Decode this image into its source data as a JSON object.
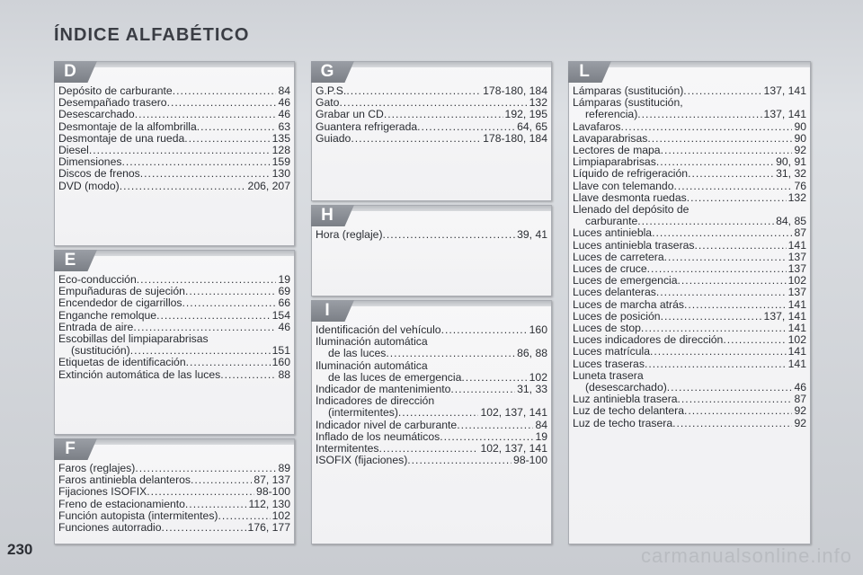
{
  "title": "ÍNDICE ALFABÉTICO",
  "page_number": "230",
  "watermark": "carmanualsonline.info",
  "sections": {
    "D": {
      "letter": "D",
      "entries": [
        {
          "t": "Depósito de carburante",
          "p": "84"
        },
        {
          "t": "Desempañado trasero",
          "p": "46"
        },
        {
          "t": "Desescarchado",
          "p": "46"
        },
        {
          "t": "Desmontaje de la alfombrilla",
          "p": "63"
        },
        {
          "t": "Desmontaje de una rueda",
          "p": "135"
        },
        {
          "t": "Diesel",
          "p": "128"
        },
        {
          "t": "Dimensiones",
          "p": "159"
        },
        {
          "t": "Discos de frenos",
          "p": "130"
        },
        {
          "t": "DVD (modo)",
          "p": "206, 207"
        }
      ]
    },
    "E": {
      "letter": "E",
      "entries": [
        {
          "t": "Eco-conducción",
          "p": "19"
        },
        {
          "t": "Empuñaduras de sujeción",
          "p": "69"
        },
        {
          "t": "Encendedor de cigarrillos",
          "p": "66"
        },
        {
          "t": "Enganche remolque",
          "p": "154"
        },
        {
          "t": "Entrada de aire",
          "p": "46"
        },
        {
          "t": "Escobillas del limpiaparabrisas",
          "p": ""
        },
        {
          "t": "(sustitución)",
          "p": "151"
        },
        {
          "t": "Etiquetas de identificación",
          "p": "160"
        },
        {
          "t": "Extinción automática de las luces",
          "p": "88"
        }
      ]
    },
    "F": {
      "letter": "F",
      "entries": [
        {
          "t": "Faros (reglajes)",
          "p": "89"
        },
        {
          "t": "Faros antiniebla delanteros",
          "p": "87, 137"
        },
        {
          "t": "Fijaciones ISOFIX",
          "p": "98-100"
        },
        {
          "t": "Freno de estacionamiento",
          "p": "112, 130"
        },
        {
          "t": "Función autopista (intermitentes)",
          "p": "102"
        },
        {
          "t": "Funciones autorradio",
          "p": "176, 177"
        }
      ]
    },
    "G": {
      "letter": "G",
      "entries": [
        {
          "t": "G.P.S.",
          "p": "178-180, 184"
        },
        {
          "t": "Gato",
          "p": "132"
        },
        {
          "t": "Grabar un CD",
          "p": "192, 195"
        },
        {
          "t": "Guantera refrigerada",
          "p": "64, 65"
        },
        {
          "t": "Guiado",
          "p": "178-180, 184"
        }
      ]
    },
    "H": {
      "letter": "H",
      "entries": [
        {
          "t": "Hora (reglaje)",
          "p": "39, 41"
        }
      ]
    },
    "I": {
      "letter": "I",
      "entries": [
        {
          "t": "Identificación del vehículo",
          "p": "160"
        },
        {
          "t": "Iluminación automática",
          "p": ""
        },
        {
          "t": "de las luces",
          "p": "86, 88"
        },
        {
          "t": "Iluminación automática",
          "p": ""
        },
        {
          "t": "de las luces de emergencia",
          "p": "102"
        },
        {
          "t": "Indicador de mantenimiento",
          "p": "31, 33"
        },
        {
          "t": "Indicadores de dirección",
          "p": ""
        },
        {
          "t": "(intermitentes)",
          "p": "102, 137, 141"
        },
        {
          "t": "Indicador nivel de carburante",
          "p": "84"
        },
        {
          "t": "Inflado de los neumáticos",
          "p": "19"
        },
        {
          "t": "Intermitentes",
          "p": "102, 137, 141"
        },
        {
          "t": "ISOFIX (fijaciones)",
          "p": "98-100"
        }
      ]
    },
    "L": {
      "letter": "L",
      "entries": [
        {
          "t": "Lámparas (sustitución)",
          "p": "137, 141"
        },
        {
          "t": "Lámparas (sustitución,",
          "p": ""
        },
        {
          "t": "referencia)",
          "p": "137, 141"
        },
        {
          "t": "Lavafaros",
          "p": "90"
        },
        {
          "t": "Lavaparabrisas",
          "p": "90"
        },
        {
          "t": "Lectores de mapa",
          "p": "92"
        },
        {
          "t": "Limpiaparabrisas",
          "p": "90, 91"
        },
        {
          "t": "Líquido de refrigeración",
          "p": "31, 32"
        },
        {
          "t": "Llave con telemando",
          "p": "76"
        },
        {
          "t": "Llave desmonta ruedas",
          "p": "132"
        },
        {
          "t": "Llenado del depósito de",
          "p": ""
        },
        {
          "t": "carburante",
          "p": "84, 85"
        },
        {
          "t": "Luces antiniebla",
          "p": "87"
        },
        {
          "t": "Luces antiniebla traseras",
          "p": "141"
        },
        {
          "t": "Luces de carretera",
          "p": "137"
        },
        {
          "t": "Luces de cruce",
          "p": "137"
        },
        {
          "t": "Luces de emergencia",
          "p": "102"
        },
        {
          "t": "Luces delanteras",
          "p": "137"
        },
        {
          "t": "Luces de marcha atrás",
          "p": "141"
        },
        {
          "t": "Luces de posición",
          "p": "137, 141"
        },
        {
          "t": "Luces de stop",
          "p": "141"
        },
        {
          "t": "Luces indicadores de dirección",
          "p": "102"
        },
        {
          "t": "Luces matrícula",
          "p": "141"
        },
        {
          "t": "Luces traseras",
          "p": "141"
        },
        {
          "t": "Luneta trasera",
          "p": ""
        },
        {
          "t": "(desescarchado)",
          "p": "46"
        },
        {
          "t": "Luz antiniebla trasera",
          "p": "87"
        },
        {
          "t": "Luz de techo delantera",
          "p": "92"
        },
        {
          "t": "Luz de techo trasera",
          "p": "92"
        }
      ]
    }
  }
}
